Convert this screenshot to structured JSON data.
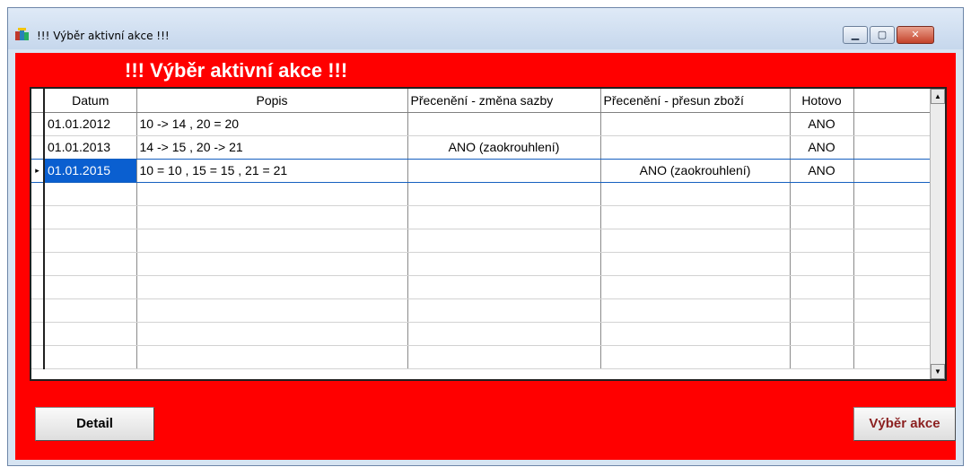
{
  "window": {
    "title": "!!! Výběr aktivní akce !!!"
  },
  "heading": "!!! Výběr aktivní akce !!!",
  "grid": {
    "columns": [
      "Datum",
      "Popis",
      "Přecenění - změna sazby",
      "Přecenění - přesun zboží",
      "Hotovo",
      ""
    ],
    "rows": [
      {
        "datum": "01.01.2012",
        "popis": "10 -> 14 , 20 = 20",
        "zmena": "",
        "presun": "",
        "hotovo": "ANO"
      },
      {
        "datum": "01.01.2013",
        "popis": "14 -> 15 , 20 -> 21",
        "zmena": "ANO (zaokrouhlení)",
        "presun": "",
        "hotovo": "ANO"
      },
      {
        "datum": "01.01.2015",
        "popis": "10 = 10 , 15 = 15 , 21 = 21",
        "zmena": "",
        "presun": "ANO (zaokrouhlení)",
        "hotovo": "ANO"
      }
    ],
    "selected_row": 2
  },
  "buttons": {
    "detail": "Detail",
    "vyber": "Výběr akce"
  },
  "colors": {
    "background": "#ff0000",
    "selection": "#0a5fd0"
  }
}
